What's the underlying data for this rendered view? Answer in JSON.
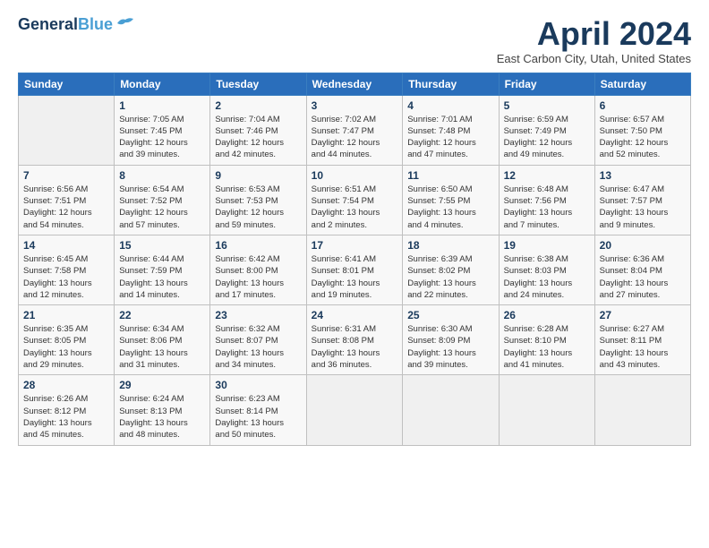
{
  "logo": {
    "line1": "General",
    "line2": "Blue"
  },
  "title": "April 2024",
  "subtitle": "East Carbon City, Utah, United States",
  "days_of_week": [
    "Sunday",
    "Monday",
    "Tuesday",
    "Wednesday",
    "Thursday",
    "Friday",
    "Saturday"
  ],
  "weeks": [
    [
      {
        "day": "",
        "info": ""
      },
      {
        "day": "1",
        "info": "Sunrise: 7:05 AM\nSunset: 7:45 PM\nDaylight: 12 hours\nand 39 minutes."
      },
      {
        "day": "2",
        "info": "Sunrise: 7:04 AM\nSunset: 7:46 PM\nDaylight: 12 hours\nand 42 minutes."
      },
      {
        "day": "3",
        "info": "Sunrise: 7:02 AM\nSunset: 7:47 PM\nDaylight: 12 hours\nand 44 minutes."
      },
      {
        "day": "4",
        "info": "Sunrise: 7:01 AM\nSunset: 7:48 PM\nDaylight: 12 hours\nand 47 minutes."
      },
      {
        "day": "5",
        "info": "Sunrise: 6:59 AM\nSunset: 7:49 PM\nDaylight: 12 hours\nand 49 minutes."
      },
      {
        "day": "6",
        "info": "Sunrise: 6:57 AM\nSunset: 7:50 PM\nDaylight: 12 hours\nand 52 minutes."
      }
    ],
    [
      {
        "day": "7",
        "info": "Sunrise: 6:56 AM\nSunset: 7:51 PM\nDaylight: 12 hours\nand 54 minutes."
      },
      {
        "day": "8",
        "info": "Sunrise: 6:54 AM\nSunset: 7:52 PM\nDaylight: 12 hours\nand 57 minutes."
      },
      {
        "day": "9",
        "info": "Sunrise: 6:53 AM\nSunset: 7:53 PM\nDaylight: 12 hours\nand 59 minutes."
      },
      {
        "day": "10",
        "info": "Sunrise: 6:51 AM\nSunset: 7:54 PM\nDaylight: 13 hours\nand 2 minutes."
      },
      {
        "day": "11",
        "info": "Sunrise: 6:50 AM\nSunset: 7:55 PM\nDaylight: 13 hours\nand 4 minutes."
      },
      {
        "day": "12",
        "info": "Sunrise: 6:48 AM\nSunset: 7:56 PM\nDaylight: 13 hours\nand 7 minutes."
      },
      {
        "day": "13",
        "info": "Sunrise: 6:47 AM\nSunset: 7:57 PM\nDaylight: 13 hours\nand 9 minutes."
      }
    ],
    [
      {
        "day": "14",
        "info": "Sunrise: 6:45 AM\nSunset: 7:58 PM\nDaylight: 13 hours\nand 12 minutes."
      },
      {
        "day": "15",
        "info": "Sunrise: 6:44 AM\nSunset: 7:59 PM\nDaylight: 13 hours\nand 14 minutes."
      },
      {
        "day": "16",
        "info": "Sunrise: 6:42 AM\nSunset: 8:00 PM\nDaylight: 13 hours\nand 17 minutes."
      },
      {
        "day": "17",
        "info": "Sunrise: 6:41 AM\nSunset: 8:01 PM\nDaylight: 13 hours\nand 19 minutes."
      },
      {
        "day": "18",
        "info": "Sunrise: 6:39 AM\nSunset: 8:02 PM\nDaylight: 13 hours\nand 22 minutes."
      },
      {
        "day": "19",
        "info": "Sunrise: 6:38 AM\nSunset: 8:03 PM\nDaylight: 13 hours\nand 24 minutes."
      },
      {
        "day": "20",
        "info": "Sunrise: 6:36 AM\nSunset: 8:04 PM\nDaylight: 13 hours\nand 27 minutes."
      }
    ],
    [
      {
        "day": "21",
        "info": "Sunrise: 6:35 AM\nSunset: 8:05 PM\nDaylight: 13 hours\nand 29 minutes."
      },
      {
        "day": "22",
        "info": "Sunrise: 6:34 AM\nSunset: 8:06 PM\nDaylight: 13 hours\nand 31 minutes."
      },
      {
        "day": "23",
        "info": "Sunrise: 6:32 AM\nSunset: 8:07 PM\nDaylight: 13 hours\nand 34 minutes."
      },
      {
        "day": "24",
        "info": "Sunrise: 6:31 AM\nSunset: 8:08 PM\nDaylight: 13 hours\nand 36 minutes."
      },
      {
        "day": "25",
        "info": "Sunrise: 6:30 AM\nSunset: 8:09 PM\nDaylight: 13 hours\nand 39 minutes."
      },
      {
        "day": "26",
        "info": "Sunrise: 6:28 AM\nSunset: 8:10 PM\nDaylight: 13 hours\nand 41 minutes."
      },
      {
        "day": "27",
        "info": "Sunrise: 6:27 AM\nSunset: 8:11 PM\nDaylight: 13 hours\nand 43 minutes."
      }
    ],
    [
      {
        "day": "28",
        "info": "Sunrise: 6:26 AM\nSunset: 8:12 PM\nDaylight: 13 hours\nand 45 minutes."
      },
      {
        "day": "29",
        "info": "Sunrise: 6:24 AM\nSunset: 8:13 PM\nDaylight: 13 hours\nand 48 minutes."
      },
      {
        "day": "30",
        "info": "Sunrise: 6:23 AM\nSunset: 8:14 PM\nDaylight: 13 hours\nand 50 minutes."
      },
      {
        "day": "",
        "info": ""
      },
      {
        "day": "",
        "info": ""
      },
      {
        "day": "",
        "info": ""
      },
      {
        "day": "",
        "info": ""
      }
    ]
  ]
}
